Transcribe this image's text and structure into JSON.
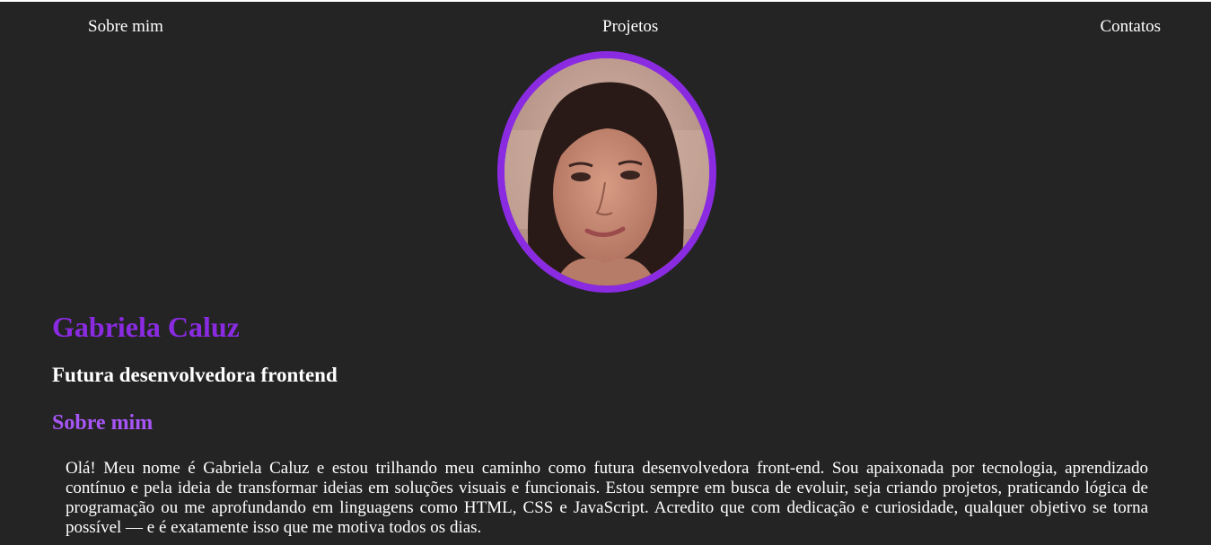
{
  "nav": {
    "about": "Sobre mim",
    "projects": "Projetos",
    "contacts": "Contatos"
  },
  "profile": {
    "name": "Gabriela Caluz",
    "subtitle": "Futura desenvolvedora frontend",
    "avatar_icon": "profile-photo"
  },
  "about": {
    "heading": "Sobre mim",
    "text": "Olá! Meu nome é Gabriela Caluz e estou trilhando meu caminho como futura desenvolvedora front-end. Sou apaixonada por tecnologia, aprendizado contínuo e pela ideia de transformar ideias em soluções visuais e funcionais. Estou sempre em busca de evoluir, seja criando projetos, praticando lógica de programação ou me aprofundando em linguagens como HTML, CSS e JavaScript. Acredito que com dedicação e curiosidade, qualquer objetivo se torna possível — e é exatamente isso que me motiva todos os dias."
  },
  "colors": {
    "background": "#242424",
    "accent": "#8a2be2",
    "heading_accent": "#a855f7",
    "text": "#ffffff"
  }
}
